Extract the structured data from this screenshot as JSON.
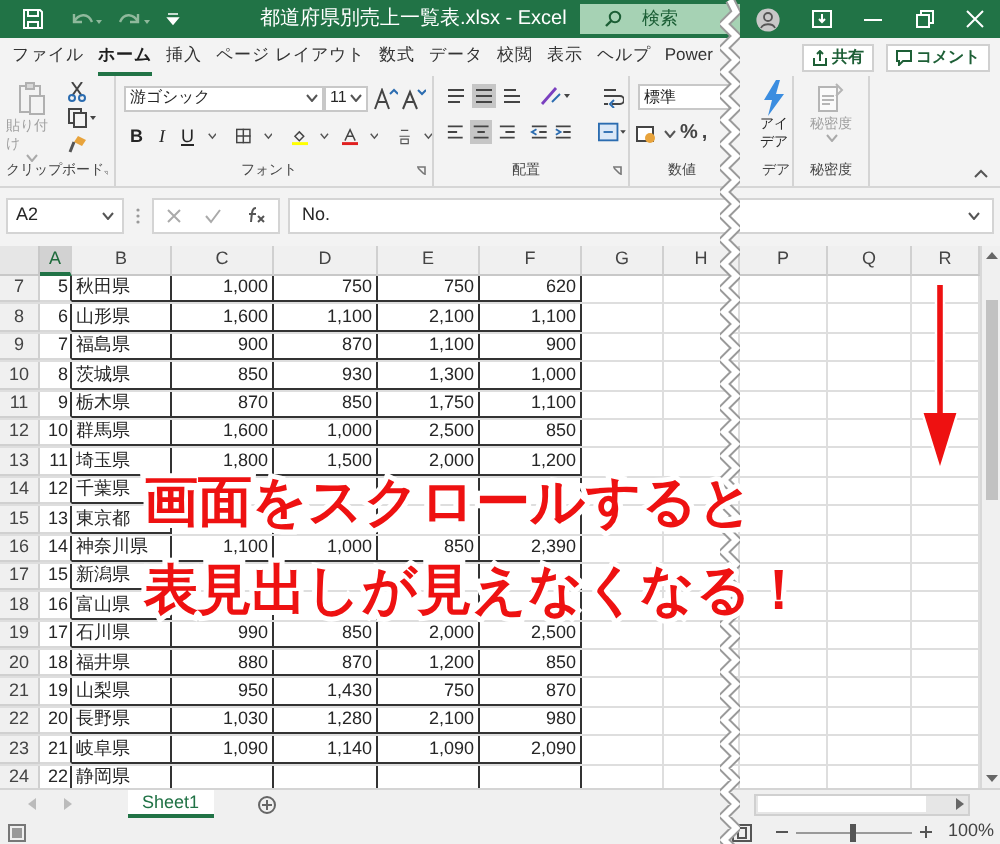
{
  "window": {
    "title": "都道府県別売上一覧表.xlsx - Excel"
  },
  "search_box": {
    "label": "検索"
  },
  "ribbon_tabs": [
    {
      "label": "ファイル",
      "selected": false
    },
    {
      "label": "ホーム",
      "selected": true
    },
    {
      "label": "挿入",
      "selected": false
    },
    {
      "label": "ページ レイアウト",
      "selected": false
    },
    {
      "label": "数式",
      "selected": false
    },
    {
      "label": "データ",
      "selected": false
    },
    {
      "label": "校閲",
      "selected": false
    },
    {
      "label": "表示",
      "selected": false
    },
    {
      "label": "ヘルプ",
      "selected": false
    },
    {
      "label": "Power",
      "selected": false
    }
  ],
  "share_button": "共有",
  "comment_button": "コメント",
  "ribbon": {
    "clipboard": {
      "paste": "貼り付け",
      "label": "クリップボード"
    },
    "font": {
      "name": "游ゴシック",
      "size": "11",
      "styles": [
        {
          "label": "B",
          "kind": "bold"
        },
        {
          "label": "I",
          "kind": "italic"
        },
        {
          "label": "U",
          "kind": "underline"
        }
      ],
      "label": "フォント"
    },
    "alignment": {
      "label": "配置"
    },
    "number": {
      "format": "標準",
      "symbols": [
        "%",
        ","
      ],
      "label": "数値"
    },
    "ideas": {
      "button": "アイデア",
      "label": "デア"
    },
    "sensitivity": {
      "button": "秘密度",
      "label": "秘密度"
    }
  },
  "formula_bar": {
    "name_box": "A2",
    "value": "No."
  },
  "columns": [
    {
      "label": "A",
      "selected": true
    },
    {
      "label": "B",
      "selected": false
    },
    {
      "label": "C",
      "selected": false
    },
    {
      "label": "D",
      "selected": false
    },
    {
      "label": "E",
      "selected": false
    },
    {
      "label": "F",
      "selected": false
    },
    {
      "label": "G",
      "selected": false
    },
    {
      "label": "H",
      "selected": false
    },
    {
      "label": "P",
      "selected": false
    },
    {
      "label": "Q",
      "selected": false
    },
    {
      "label": "R",
      "selected": false
    }
  ],
  "rows": [
    {
      "number": "7",
      "cells": [
        "5",
        "秋田県",
        "1,000",
        "750",
        "750",
        "620"
      ]
    },
    {
      "number": "8",
      "cells": [
        "6",
        "山形県",
        "1,600",
        "1,100",
        "2,100",
        "1,100"
      ]
    },
    {
      "number": "9",
      "cells": [
        "7",
        "福島県",
        "900",
        "870",
        "1,100",
        "900"
      ]
    },
    {
      "number": "10",
      "cells": [
        "8",
        "茨城県",
        "850",
        "930",
        "1,300",
        "1,000"
      ]
    },
    {
      "number": "11",
      "cells": [
        "9",
        "栃木県",
        "870",
        "850",
        "1,750",
        "1,100"
      ]
    },
    {
      "number": "12",
      "cells": [
        "10",
        "群馬県",
        "1,600",
        "1,000",
        "2,500",
        "850"
      ]
    },
    {
      "number": "13",
      "cells": [
        "11",
        "埼玉県",
        "1,800",
        "1,500",
        "2,000",
        "1,200"
      ]
    },
    {
      "number": "14",
      "cells": [
        "12",
        "千葉県",
        null,
        null,
        null,
        null
      ]
    },
    {
      "number": "15",
      "cells": [
        "13",
        "東京都",
        null,
        null,
        null,
        null
      ]
    },
    {
      "number": "16",
      "cells": [
        "14",
        "神奈川県",
        "1,100",
        "1,000",
        "850",
        "2,390"
      ]
    },
    {
      "number": "17",
      "cells": [
        "15",
        "新潟県",
        null,
        null,
        null,
        null
      ]
    },
    {
      "number": "18",
      "cells": [
        "16",
        "富山県",
        null,
        null,
        null,
        null
      ]
    },
    {
      "number": "19",
      "cells": [
        "17",
        "石川県",
        "990",
        "850",
        "2,000",
        "2,500"
      ]
    },
    {
      "number": "20",
      "cells": [
        "18",
        "福井県",
        "880",
        "870",
        "1,200",
        "850"
      ]
    },
    {
      "number": "21",
      "cells": [
        "19",
        "山梨県",
        "950",
        "1,430",
        "750",
        "870"
      ]
    },
    {
      "number": "22",
      "cells": [
        "20",
        "長野県",
        "1,030",
        "1,280",
        "2,100",
        "980"
      ]
    },
    {
      "number": "23",
      "cells": [
        "21",
        "岐阜県",
        "1,090",
        "1,140",
        "1,090",
        "2,090"
      ]
    },
    {
      "number": "24",
      "cells": [
        "22",
        "静岡県",
        null,
        null,
        null,
        null
      ]
    }
  ],
  "overlay": {
    "lines": [
      "画面をスクロールすると",
      "表見出しが見えなくなる！"
    ]
  },
  "sheet_tabs": [
    {
      "label": "Sheet1",
      "selected": true
    }
  ],
  "status_bar": {
    "zoom": "100%",
    "zoom_slider": {
      "level": 0.5
    }
  }
}
